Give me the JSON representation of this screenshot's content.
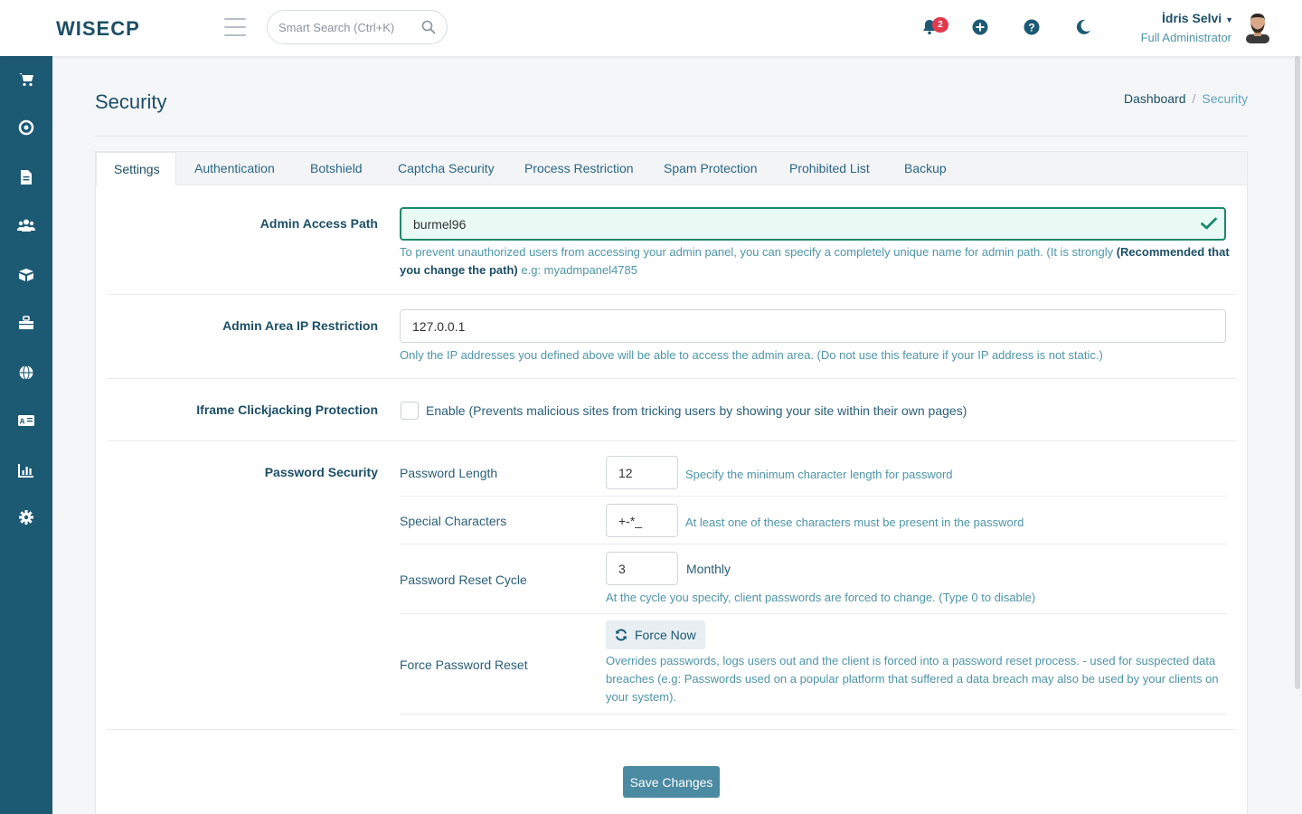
{
  "app": {
    "logo_text": "WISECP"
  },
  "header": {
    "search_placeholder": "Smart Search (Ctrl+K)",
    "notifications_count": "2",
    "user_name": "İdris Selvi",
    "user_role": "Full Administrator"
  },
  "sidebar": {
    "items": [
      {
        "icon": "cart-icon"
      },
      {
        "icon": "support-icon"
      },
      {
        "icon": "document-icon"
      },
      {
        "icon": "users-icon"
      },
      {
        "icon": "box-icon"
      },
      {
        "icon": "toolbox-icon"
      },
      {
        "icon": "globe-icon"
      },
      {
        "icon": "language-icon"
      },
      {
        "icon": "chart-icon"
      },
      {
        "icon": "gear-icon"
      }
    ]
  },
  "page": {
    "title": "Security",
    "breadcrumb": {
      "home": "Dashboard",
      "separator": "/",
      "current": "Security"
    }
  },
  "tabs": [
    {
      "label": "Settings",
      "active": true
    },
    {
      "label": "Authentication"
    },
    {
      "label": "Botshield"
    },
    {
      "label": "Captcha Security"
    },
    {
      "label": "Process Restriction"
    },
    {
      "label": "Spam Protection"
    },
    {
      "label": "Prohibited List"
    },
    {
      "label": "Backup"
    }
  ],
  "settings": {
    "admin_path": {
      "label": "Admin Access Path",
      "value": "burmel96",
      "help_text": "To prevent unauthorized users from accessing your admin panel, you can specify a completely unique name for admin path. (It is strongly ",
      "help_strong": "(Recommended that you change the path)",
      "help_example": " e.g: myadmpanel4785"
    },
    "ip_restriction": {
      "label": "Admin Area IP Restriction",
      "value": "127.0.0.1",
      "help": "Only the IP addresses you defined above will be able to access the admin area. (Do not use this feature if your IP address is not static.)"
    },
    "clickjacking": {
      "label": "Iframe Clickjacking Protection",
      "checkbox_label": "Enable (Prevents malicious sites from tricking users by showing your site within their own pages)"
    },
    "password": {
      "label": "Password Security",
      "length_label": "Password Length",
      "length_value": "12",
      "length_help": "Specify the minimum character length for password",
      "special_label": "Special Characters",
      "special_value": "+-*_",
      "special_help": "At least one of these characters must be present in the password",
      "reset_cycle_label": "Password Reset Cycle",
      "reset_cycle_value": "3",
      "reset_cycle_unit": "Monthly",
      "reset_cycle_help": "At the cycle you specify, client passwords are forced to change. (Type 0 to disable)",
      "force_label": "Force Password Reset",
      "force_button": "Force Now",
      "force_help": "Overrides passwords, logs users out and the client is forced into a password reset process. - used for suspected data breaches (e.g: Passwords used on a popular platform that suffered a data breach may also be used by your clients on your system)."
    }
  },
  "save_button": "Save Changes",
  "colors": {
    "sidebar": "#1c5a74",
    "accent": "#4a8aa2",
    "valid": "#1a8a6a",
    "badge": "#e03b4d"
  }
}
